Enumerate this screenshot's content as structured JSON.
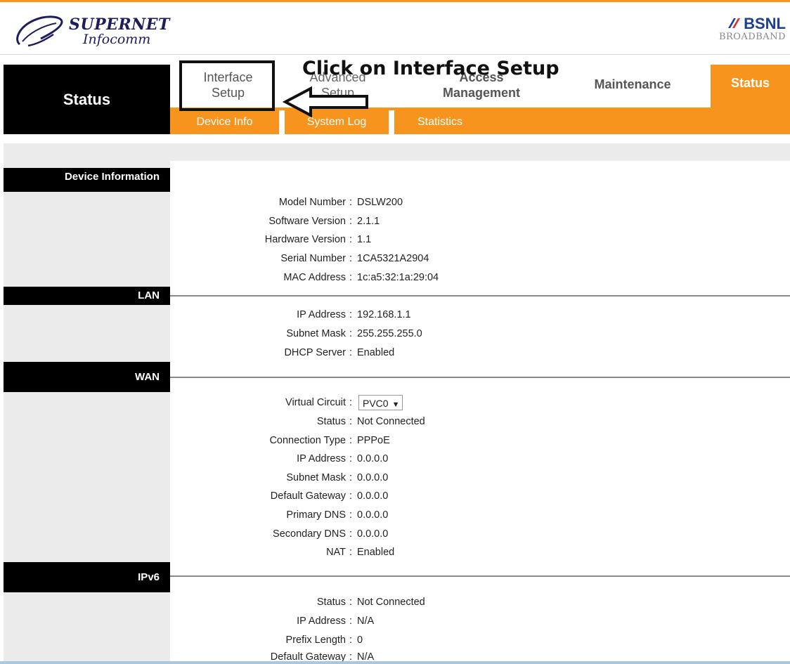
{
  "header": {
    "brand_name": "SUPERNET",
    "brand_sub": "Infocomm",
    "partner_name": "BSNL",
    "partner_sub": "BROADBAND"
  },
  "nav": {
    "section_title": "Status",
    "tabs": [
      {
        "label_line1": "Interface",
        "label_line2": "Setup"
      },
      {
        "label_line1": "Advanced",
        "label_line2": "Setup"
      },
      {
        "label_line1": "Access",
        "label_line2": "Management"
      },
      {
        "label_line1": "Maintenance"
      },
      {
        "label_line1": "Status"
      }
    ],
    "subtabs": [
      "Device Info",
      "System Log",
      "Statistics"
    ]
  },
  "annotation": {
    "instruction": "Click on Interface Setup"
  },
  "sections": {
    "device": {
      "title": "Device Information",
      "rows": [
        {
          "label": "Model Number",
          "value": "DSLW200"
        },
        {
          "label": "Software Version",
          "value": "2.1.1"
        },
        {
          "label": "Hardware Version",
          "value": "1.1"
        },
        {
          "label": "Serial Number",
          "value": "1CA5321A2904"
        },
        {
          "label": "MAC Address",
          "value": "1c:a5:32:1a:29:04"
        }
      ]
    },
    "lan": {
      "title": "LAN",
      "rows": [
        {
          "label": "IP Address",
          "value": "192.168.1.1"
        },
        {
          "label": "Subnet Mask",
          "value": "255.255.255.0"
        },
        {
          "label": "DHCP Server",
          "value": "Enabled"
        }
      ]
    },
    "wan": {
      "title": "WAN",
      "virtual_circuit_label": "Virtual Circuit",
      "virtual_circuit_value": "PVC0",
      "rows": [
        {
          "label": "Status",
          "value": "Not Connected"
        },
        {
          "label": "Connection Type",
          "value": "PPPoE"
        },
        {
          "label": "IP Address",
          "value": "0.0.0.0"
        },
        {
          "label": "Subnet Mask",
          "value": "0.0.0.0"
        },
        {
          "label": "Default Gateway",
          "value": "0.0.0.0"
        },
        {
          "label": "Primary DNS",
          "value": "0.0.0.0"
        },
        {
          "label": "Secondary DNS",
          "value": "0.0.0.0"
        },
        {
          "label": "NAT",
          "value": "Enabled"
        }
      ]
    },
    "ipv6": {
      "title": "IPv6",
      "rows": [
        {
          "label": "Status",
          "value": "Not Connected"
        },
        {
          "label": "IP Address",
          "value": "N/A"
        },
        {
          "label": "Prefix Length",
          "value": "0"
        },
        {
          "label": "Default Gateway",
          "value": "N/A"
        }
      ]
    }
  },
  "colors": {
    "accent": "#f7941d",
    "nav_dark": "#000000",
    "sidebar": "#ebebeb"
  }
}
